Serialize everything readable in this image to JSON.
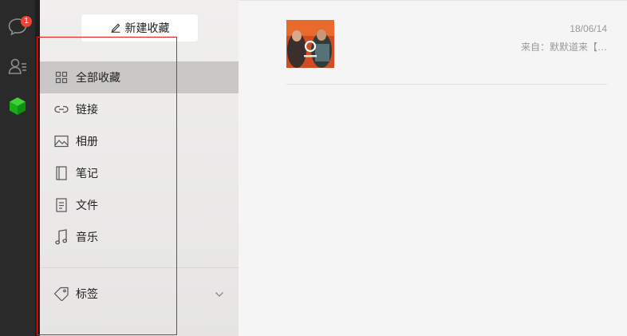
{
  "iconbar": {
    "chat_badge": "1",
    "icons": [
      "chat-bubble-icon",
      "contacts-icon",
      "favorites-cube-icon"
    ]
  },
  "sidebar": {
    "new_button_label": "新建收藏",
    "items": [
      {
        "label": "全部收藏",
        "icon": "grid-icon",
        "active": true
      },
      {
        "label": "链接",
        "icon": "link-icon"
      },
      {
        "label": "相册",
        "icon": "image-icon"
      },
      {
        "label": "笔记",
        "icon": "notebook-icon"
      },
      {
        "label": "文件",
        "icon": "file-icon"
      },
      {
        "label": "音乐",
        "icon": "music-note-icon"
      }
    ],
    "tags_label": "标签"
  },
  "main": {
    "items": [
      {
        "date": "18/06/14",
        "source": "来自：默默道来【…",
        "thumbnail": "album-cover-image"
      }
    ]
  },
  "colors": {
    "iconbar_bg": "#2b2a2a",
    "badge": "#f04134",
    "active_item": "#c9c8c7",
    "cube_green": "#1aad19",
    "annotation_box": "#e81c1c"
  }
}
